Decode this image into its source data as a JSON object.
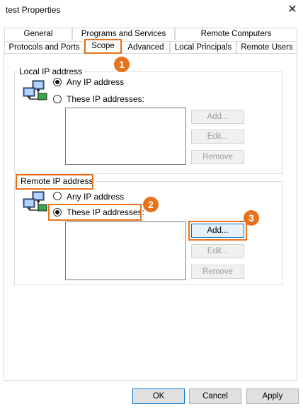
{
  "window": {
    "title": "test Properties",
    "close_label": "✕"
  },
  "tabs": {
    "row1": [
      "General",
      "Programs and Services",
      "Remote Computers"
    ],
    "row2": [
      "Protocols and Ports",
      "Scope",
      "Advanced",
      "Local Principals",
      "Remote Users"
    ],
    "selected": "Scope"
  },
  "local": {
    "group_label": "Local IP address",
    "any_label": "Any IP address",
    "these_label": "These IP addresses:",
    "selected": "any",
    "buttons": {
      "add": "Add...",
      "edit": "Edit...",
      "remove": "Remove"
    }
  },
  "remote": {
    "group_label": "Remote IP address",
    "any_label": "Any IP address",
    "these_label": "These IP addresses:",
    "selected": "these",
    "buttons": {
      "add": "Add...",
      "edit": "Edit...",
      "remove": "Remove"
    }
  },
  "footer": {
    "ok": "OK",
    "cancel": "Cancel",
    "apply": "Apply"
  },
  "callouts": [
    "1",
    "2",
    "3"
  ],
  "colors": {
    "highlight": "#e8721c",
    "focus": "#0078d7"
  }
}
